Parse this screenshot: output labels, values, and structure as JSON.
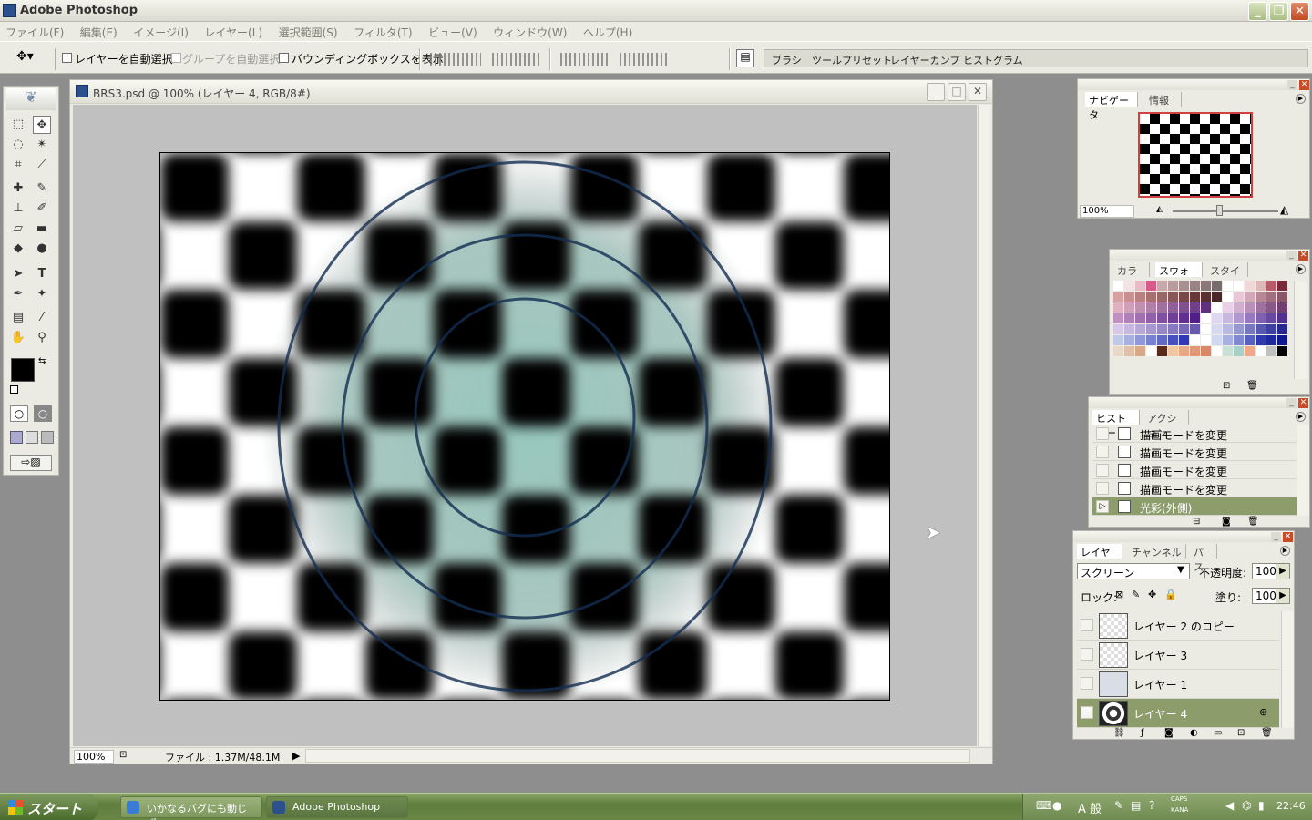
{
  "app": {
    "title": "Adobe Photoshop"
  },
  "menu": [
    "ファイル(F)",
    "編集(E)",
    "イメージ(I)",
    "レイヤー(L)",
    "選択範囲(S)",
    "フィルタ(T)",
    "ビュー(V)",
    "ウィンドウ(W)",
    "ヘルプ(H)"
  ],
  "options": {
    "auto_select_layer": "レイヤーを自動選択",
    "auto_select_group": "グループを自動選択",
    "show_bounding_box": "バウンディングボックスを表示",
    "wells": [
      "ブラシ",
      "ツールプリセット",
      "レイヤーカンプ",
      "ヒストグラム"
    ]
  },
  "document": {
    "title": "BRS3.psd @ 100% (レイヤー 4, RGB/8#)",
    "zoom": "100%",
    "file_info": "ファイル : 1.37M/48.1M"
  },
  "navigator": {
    "tabs": [
      "ナビゲータ",
      "情報"
    ],
    "zoom": "100%"
  },
  "swatches": {
    "tabs": [
      "カラー",
      "スウォッチ",
      "スタイル"
    ],
    "colors": [
      "#ffffff",
      "#f2e4e4",
      "#e7bcc4",
      "#d85a8a",
      "#c8a8a8",
      "#b99c9c",
      "#a89090",
      "#988484",
      "#887878",
      "#786c6c",
      "#ffffff",
      "#ffffff",
      "#f0d8d8",
      "#ddb8b8",
      "#b85a6a",
      "#7a2a3a",
      "#d8a0a0",
      "#c89090",
      "#b88080",
      "#a87070",
      "#986868",
      "#885858",
      "#784848",
      "#683838",
      "#583030",
      "#482828",
      "#ffffff",
      "#e8c8d8",
      "#d0a8b8",
      "#b88898",
      "#a07080",
      "#885868",
      "#e0b0c0",
      "#d0a0b8",
      "#c090b0",
      "#b080a8",
      "#a070a0",
      "#906098",
      "#805090",
      "#704088",
      "#603080",
      "#ffffff",
      "#e8d0e8",
      "#d0b0d0",
      "#b890b8",
      "#a070a0",
      "#885888",
      "#704070",
      "#c090c0",
      "#b080b8",
      "#a070b0",
      "#9060a8",
      "#8050a0",
      "#704098",
      "#603090",
      "#502088",
      "#ffffff",
      "#e0d8f0",
      "#c8b8e0",
      "#b098d0",
      "#9878c0",
      "#8060b0",
      "#6848a0",
      "#503090",
      "#d8c8e8",
      "#c8b8e0",
      "#b8a8d8",
      "#a898d0",
      "#9888c8",
      "#8878c0",
      "#7868b8",
      "#6858b0",
      "#ffffff",
      "#d8d8f0",
      "#b8b8e0",
      "#9898d0",
      "#7878c0",
      "#5858b0",
      "#4040a0",
      "#282890",
      "#c0c8e8",
      "#a8b0e0",
      "#9098d8",
      "#7880d0",
      "#6068c8",
      "#4850c0",
      "#3038b8",
      "#ffffff",
      "#ffffff",
      "#d0d8f0",
      "#a8b0e0",
      "#8088d0",
      "#5860c0",
      "#3038b0",
      "#2028a0",
      "#101890",
      "#e8d8c8",
      "#e0c0a8",
      "#d8a888",
      "#ffffff",
      "#5a2a1a",
      "#f0c8a0",
      "#e8a888",
      "#e09878",
      "#d88868",
      "#ffffff",
      "#c8e0d8",
      "#a8d0c8",
      "#f0a888",
      "#ffffff",
      "#c0c0c0",
      "#000000"
    ]
  },
  "history": {
    "tabs": [
      "ヒストリー",
      "アクション"
    ],
    "items": [
      {
        "label": "描画モードを変更"
      },
      {
        "label": "描画モードを変更"
      },
      {
        "label": "描画モードを変更"
      },
      {
        "label": "描画モードを変更"
      },
      {
        "label": "光彩(外側)"
      }
    ]
  },
  "layers": {
    "tabs": [
      "レイヤー",
      "チャンネル",
      "パス"
    ],
    "blend_mode": "スクリーン",
    "opacity_label": "不透明度:",
    "opacity": "100%",
    "lock_label": "ロック:",
    "fill_label": "塗り:",
    "fill": "100%",
    "items": [
      {
        "name": "レイヤー 2 のコピー"
      },
      {
        "name": "レイヤー 3"
      },
      {
        "name": "レイヤー 1"
      },
      {
        "name": "レイヤー 4"
      }
    ]
  },
  "taskbar": {
    "start": "スタート",
    "buttons": [
      "いかなるバグにも動じず...",
      "Adobe Photoshop"
    ],
    "ime": "A 般",
    "caps": "CAPS",
    "kana": "KANA",
    "clock": "22:46"
  }
}
